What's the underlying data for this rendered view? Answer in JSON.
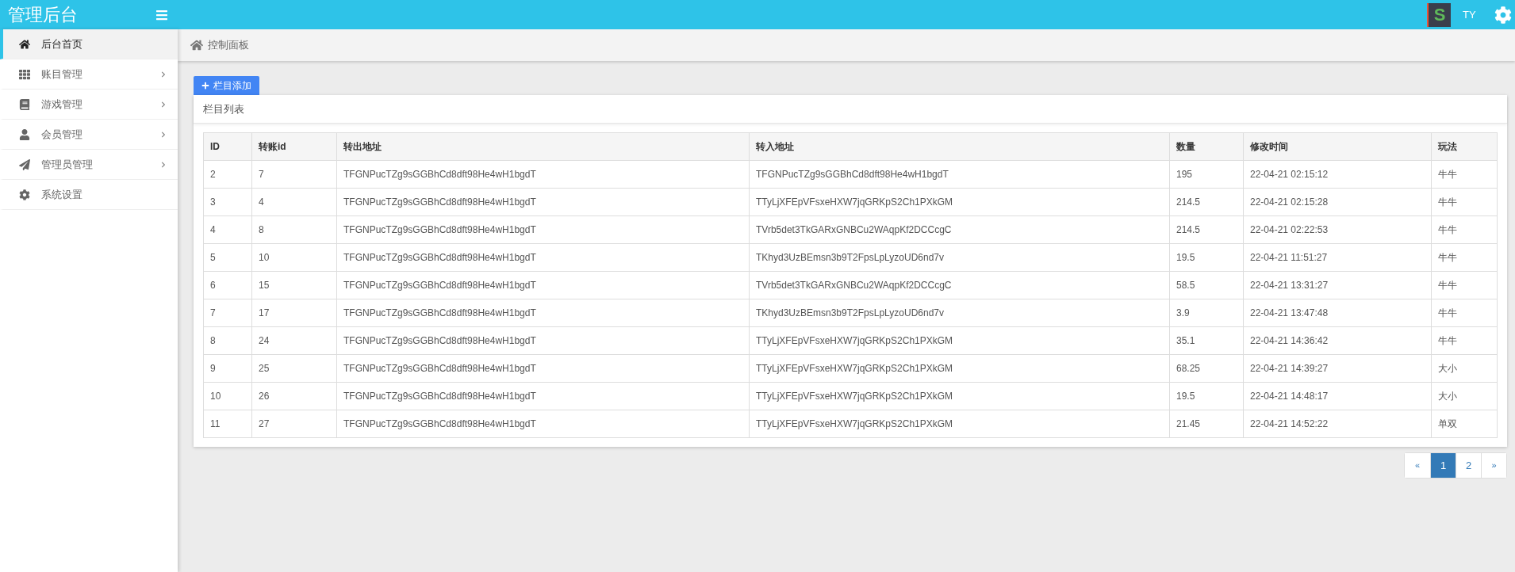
{
  "header": {
    "title": "管理后台",
    "avatar_letter": "S",
    "user": "TY"
  },
  "sidebar": {
    "items": [
      {
        "label": "后台首页",
        "selected": true,
        "has_children": false
      },
      {
        "label": "账目管理",
        "selected": false,
        "has_children": true
      },
      {
        "label": "游戏管理",
        "selected": false,
        "has_children": true
      },
      {
        "label": "会员管理",
        "selected": false,
        "has_children": true
      },
      {
        "label": "管理员管理",
        "selected": false,
        "has_children": true
      },
      {
        "label": "系统设置",
        "selected": false,
        "has_children": false
      }
    ]
  },
  "breadcrumb": "控制面板",
  "add_button": "栏目添加",
  "panel": {
    "title": "栏目列表"
  },
  "table": {
    "columns": [
      "ID",
      "转账id",
      "转出地址",
      "转入地址",
      "数量",
      "修改时间",
      "玩法"
    ],
    "rows": [
      [
        "2",
        "7",
        "TFGNPucTZg9sGGBhCd8dft98He4wH1bgdT",
        "TFGNPucTZg9sGGBhCd8dft98He4wH1bgdT",
        "195",
        "22-04-21 02:15:12",
        "牛牛"
      ],
      [
        "3",
        "4",
        "TFGNPucTZg9sGGBhCd8dft98He4wH1bgdT",
        "TTyLjXFEpVFsxeHXW7jqGRKpS2Ch1PXkGM",
        "214.5",
        "22-04-21 02:15:28",
        "牛牛"
      ],
      [
        "4",
        "8",
        "TFGNPucTZg9sGGBhCd8dft98He4wH1bgdT",
        "TVrb5det3TkGARxGNBCu2WAqpKf2DCCcgC",
        "214.5",
        "22-04-21 02:22:53",
        "牛牛"
      ],
      [
        "5",
        "10",
        "TFGNPucTZg9sGGBhCd8dft98He4wH1bgdT",
        "TKhyd3UzBEmsn3b9T2FpsLpLyzoUD6nd7v",
        "19.5",
        "22-04-21 11:51:27",
        "牛牛"
      ],
      [
        "6",
        "15",
        "TFGNPucTZg9sGGBhCd8dft98He4wH1bgdT",
        "TVrb5det3TkGARxGNBCu2WAqpKf2DCCcgC",
        "58.5",
        "22-04-21 13:31:27",
        "牛牛"
      ],
      [
        "7",
        "17",
        "TFGNPucTZg9sGGBhCd8dft98He4wH1bgdT",
        "TKhyd3UzBEmsn3b9T2FpsLpLyzoUD6nd7v",
        "3.9",
        "22-04-21 13:47:48",
        "牛牛"
      ],
      [
        "8",
        "24",
        "TFGNPucTZg9sGGBhCd8dft98He4wH1bgdT",
        "TTyLjXFEpVFsxeHXW7jqGRKpS2Ch1PXkGM",
        "35.1",
        "22-04-21 14:36:42",
        "牛牛"
      ],
      [
        "9",
        "25",
        "TFGNPucTZg9sGGBhCd8dft98He4wH1bgdT",
        "TTyLjXFEpVFsxeHXW7jqGRKpS2Ch1PXkGM",
        "68.25",
        "22-04-21 14:39:27",
        "大小"
      ],
      [
        "10",
        "26",
        "TFGNPucTZg9sGGBhCd8dft98He4wH1bgdT",
        "TTyLjXFEpVFsxeHXW7jqGRKpS2Ch1PXkGM",
        "19.5",
        "22-04-21 14:48:17",
        "大小"
      ],
      [
        "11",
        "27",
        "TFGNPucTZg9sGGBhCd8dft98He4wH1bgdT",
        "TTyLjXFEpVFsxeHXW7jqGRKpS2Ch1PXkGM",
        "21.45",
        "22-04-21 14:52:22",
        "单双"
      ]
    ]
  },
  "pagination": [
    {
      "label": "«",
      "kind": "prev",
      "selected": false
    },
    {
      "label": "1",
      "kind": "page",
      "selected": true
    },
    {
      "label": "2",
      "kind": "page",
      "selected": false
    },
    {
      "label": "»",
      "kind": "next",
      "selected": false
    }
  ]
}
